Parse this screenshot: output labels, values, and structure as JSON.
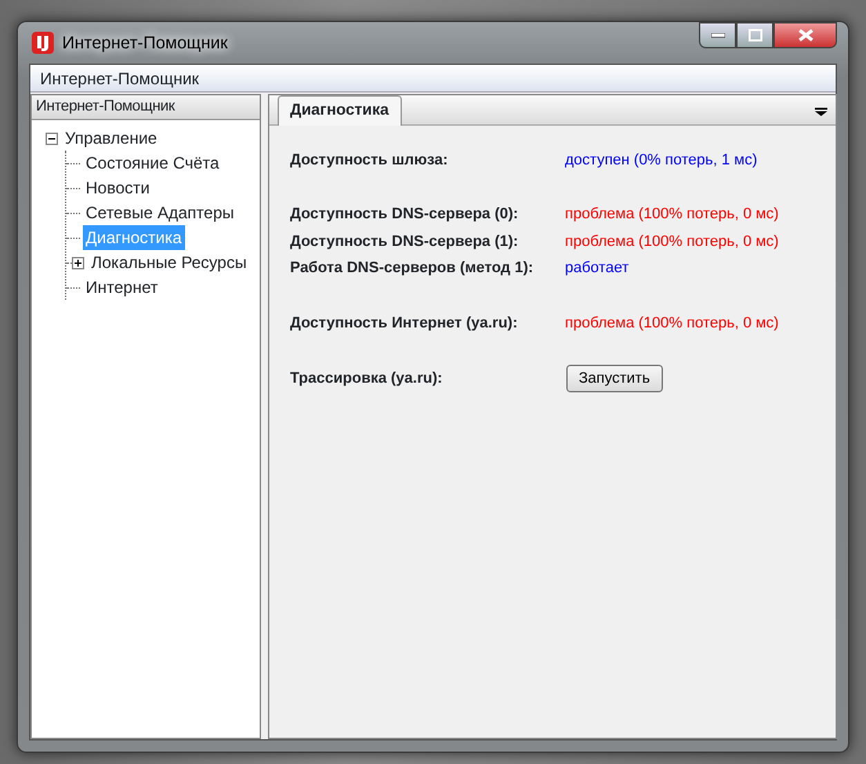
{
  "window": {
    "title": "Интернет-Помощник"
  },
  "menu_bar": {
    "title": "Интернет-Помощник"
  },
  "sidebar": {
    "title": "Интернет-Помощник",
    "tree": [
      {
        "label": "Управление",
        "expanded": true,
        "selected": false,
        "children": [
          {
            "label": "Состояние Счёта",
            "selected": false
          },
          {
            "label": "Новости",
            "selected": false
          },
          {
            "label": "Сетевые Адаптеры",
            "selected": false
          },
          {
            "label": "Диагностика",
            "selected": true
          },
          {
            "label": "Локальные Ресурсы",
            "selected": false,
            "expanded": false
          },
          {
            "label": "Интернет",
            "selected": false
          }
        ]
      }
    ]
  },
  "tabs": [
    {
      "label": "Диагностика",
      "selected": true
    }
  ],
  "sections": [
    [
      {
        "kind": "status",
        "label": "Доступность шлюза:",
        "value": "доступен (0% потерь, 1 мс)",
        "color": "#0000ff"
      }
    ],
    [
      {
        "kind": "status",
        "label": "Доступность DNS-сервера (0):",
        "value": "проблема (100% потерь, 0 мс)",
        "color": "#ff0000"
      },
      {
        "kind": "status",
        "label": "Доступность DNS-сервера (1):",
        "value": "проблема (100% потерь, 0 мс)",
        "color": "#ff0000"
      },
      {
        "kind": "status",
        "label": "Работа DNS-серверов (метод 1):",
        "value": "работает",
        "color": "#0000ff"
      }
    ],
    [
      {
        "kind": "status",
        "label": "Доступность Интернет (ya.ru):",
        "value": "проблема (100% потерь, 0 мс)",
        "color": "#ff0000"
      }
    ],
    [
      {
        "kind": "button",
        "label": "Трассировка (ya.ru):",
        "value": "Запустить"
      }
    ]
  ]
}
